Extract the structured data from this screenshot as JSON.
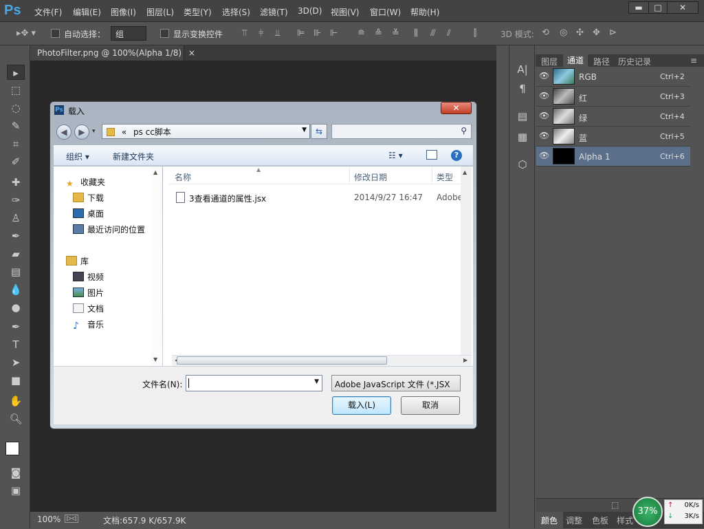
{
  "app": {
    "logo": "Ps"
  },
  "menu": [
    "文件(F)",
    "编辑(E)",
    "图像(I)",
    "图层(L)",
    "类型(Y)",
    "选择(S)",
    "滤镜(T)",
    "3D(D)",
    "视图(V)",
    "窗口(W)",
    "帮助(H)"
  ],
  "window_buttons": {
    "minimize": "▬",
    "maximize": "□",
    "close": "✕"
  },
  "options": {
    "auto_select_label": "自动选择：",
    "auto_select_value": "组",
    "show_transform_label": "显示变换控件",
    "mode3d_label": "3D 模式:"
  },
  "document": {
    "tab_title": "PhotoFilter.png @ 100%(Alpha 1/8)",
    "tab_close": "×",
    "zoom": "100%",
    "doc_info": "文档:657.9 K/657.9K"
  },
  "panel": {
    "tabs": [
      "图层",
      "通道",
      "路径",
      "历史记录"
    ],
    "active_tab": "通道",
    "channels": [
      {
        "name": "RGB",
        "shortcut": "Ctrl+2"
      },
      {
        "name": "红",
        "shortcut": "Ctrl+3"
      },
      {
        "name": "绿",
        "shortcut": "Ctrl+4"
      },
      {
        "name": "蓝",
        "shortcut": "Ctrl+5"
      },
      {
        "name": "Alpha 1",
        "shortcut": "Ctrl+6"
      }
    ],
    "bottom_tabs": [
      "颜色",
      "调整",
      "色板",
      "样式"
    ]
  },
  "network": {
    "percent": "37%",
    "up": "0K/s",
    "down": "3K/s"
  },
  "dialog": {
    "title": "载入",
    "close": "✕",
    "address": "ps cc脚本",
    "address_prefix": "«",
    "toolbar": {
      "organize": "组织 ▾",
      "new_folder": "新建文件夹"
    },
    "nav": {
      "favorites": "收藏夹",
      "downloads": "下载",
      "desktop": "桌面",
      "recent": "最近访问的位置",
      "library": "库",
      "videos": "视频",
      "pictures": "图片",
      "documents": "文档",
      "music": "音乐"
    },
    "columns": {
      "name": "名称",
      "modified": "修改日期",
      "type": "类型"
    },
    "files": [
      {
        "name": "3查看通道的属性.jsx",
        "modified": "2014/9/27 16:47",
        "type": "Adobe"
      }
    ],
    "filename_label": "文件名(N):",
    "filename_value": "",
    "filetype": "Adobe JavaScript 文件 (*.JSX",
    "load_button": "载入(L)",
    "cancel_button": "取消"
  }
}
